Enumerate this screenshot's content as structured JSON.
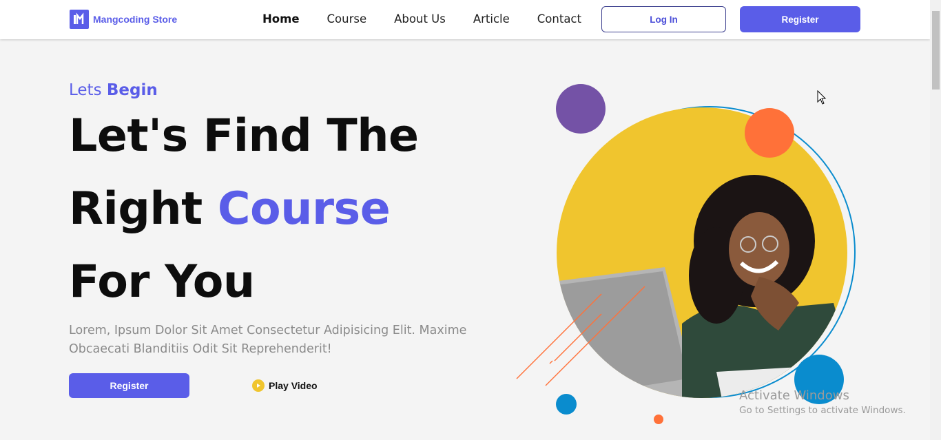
{
  "header": {
    "brand": "Mangcoding Store",
    "nav": [
      "Home",
      "Course",
      "About Us",
      "Article",
      "Contact"
    ],
    "login_label": "Log In",
    "register_label": "Register"
  },
  "hero": {
    "kicker_plain": "Lets ",
    "kicker_bold": "Begin",
    "line1": "Let's Find The",
    "line2_plain": "Right ",
    "line2_accent": "Course",
    "line3": "For You",
    "description": "Lorem, Ipsum Dolor Sit Amet Consectetur Adipisicing Elit. Maxime Obcaecati Blanditiis Odit Sit Reprehenderit!",
    "register_label": "Register",
    "play_label": "Play Video"
  },
  "watermark": {
    "title": "Activate Windows",
    "subtitle": "Go to Settings to activate Windows."
  },
  "colors": {
    "primary": "#5a5de8",
    "yellow": "#f0c52e",
    "purple": "#7452a6",
    "orange": "#ff7139",
    "blue": "#0a8cce"
  },
  "icons": [
    "logo-icon",
    "play-icon",
    "cursor-icon"
  ]
}
